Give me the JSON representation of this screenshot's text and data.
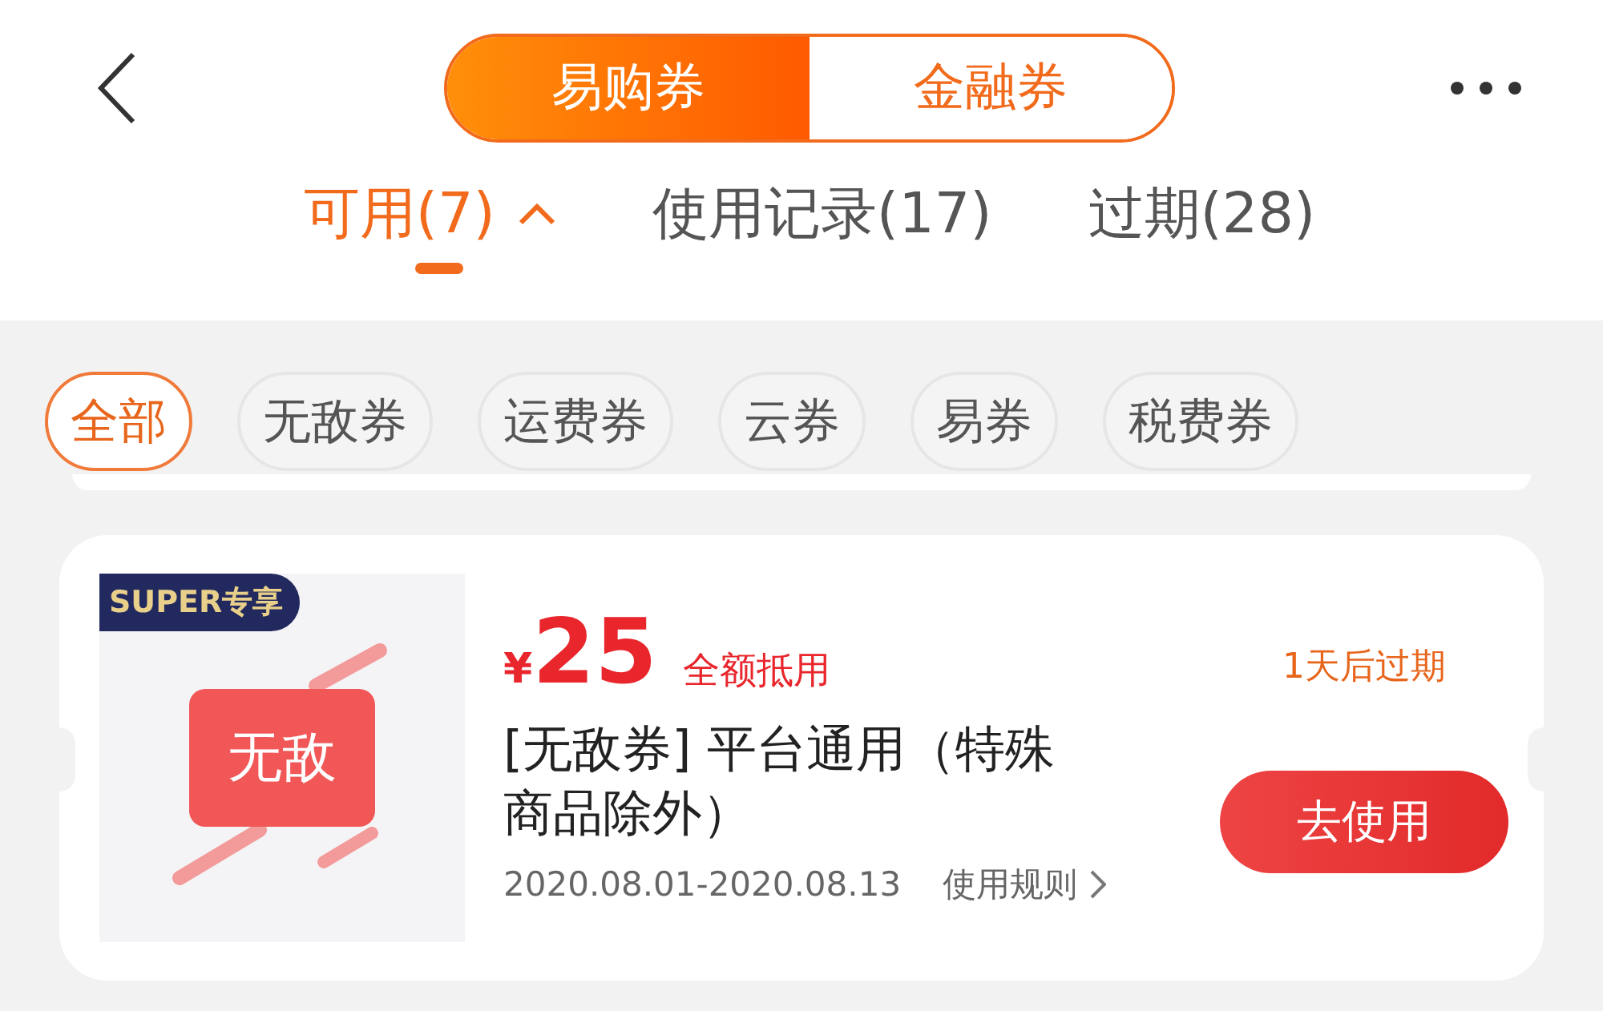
{
  "segments": [
    {
      "label": "易购券",
      "selected": true
    },
    {
      "label": "金融券",
      "selected": false
    }
  ],
  "tabs": [
    {
      "label": "可用(7)",
      "selected": true,
      "expanded": true
    },
    {
      "label": "使用记录(17)",
      "selected": false
    },
    {
      "label": "过期(28)",
      "selected": false
    }
  ],
  "filters": [
    {
      "label": "全部",
      "selected": true
    },
    {
      "label": "无敌券",
      "selected": false
    },
    {
      "label": "运费券",
      "selected": false
    },
    {
      "label": "云券",
      "selected": false
    },
    {
      "label": "易券",
      "selected": false
    },
    {
      "label": "税费券",
      "selected": false
    }
  ],
  "coupons": [
    {
      "badge": "SUPER专享",
      "image_label": "无敌",
      "currency": "¥",
      "amount": "25",
      "amount_note": "全额抵用",
      "title": "[无敌券] 平台通用（特殊商品除外）",
      "validity": "2020.08.01-2020.08.13",
      "rules_link": "使用规则",
      "expiry": "1天后过期",
      "action": "去使用"
    }
  ]
}
